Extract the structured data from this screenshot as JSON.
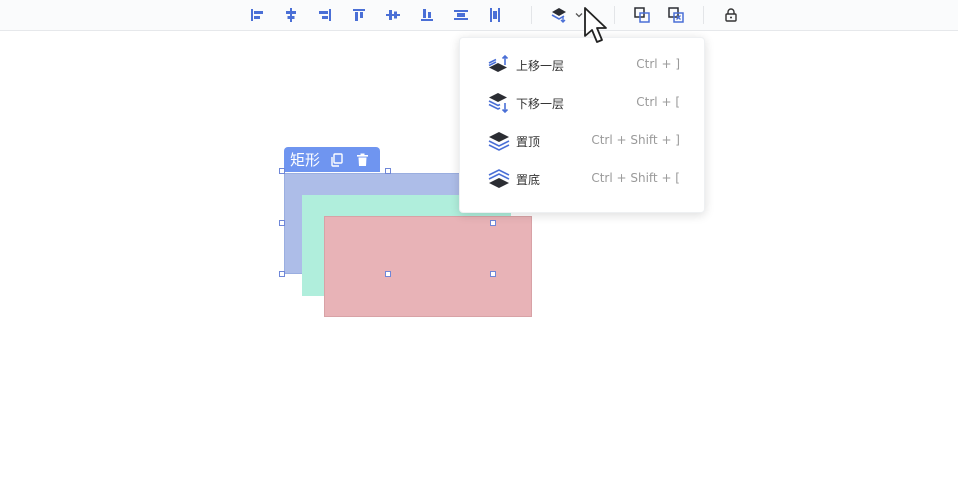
{
  "toolbar": {
    "tools": [
      {
        "name": "align-left-icon"
      },
      {
        "name": "align-center-horizontal-icon"
      },
      {
        "name": "align-right-icon"
      },
      {
        "name": "align-top-icon"
      },
      {
        "name": "align-middle-vertical-icon"
      },
      {
        "name": "align-bottom-icon"
      },
      {
        "name": "distribute-horizontal-icon"
      },
      {
        "name": "distribute-vertical-icon"
      },
      {
        "name": "layer-order-icon"
      },
      {
        "name": "chevron-down-icon"
      },
      {
        "name": "group-icon"
      },
      {
        "name": "ungroup-icon"
      },
      {
        "name": "lock-icon"
      }
    ],
    "accent_color": "#4a6fd6"
  },
  "selection": {
    "label": "矩形",
    "toolbar_color": "#6f95f0",
    "icons": [
      "copy-icon",
      "delete-icon"
    ]
  },
  "shapes": [
    {
      "name": "rectangle-blue",
      "color": "#adbde8"
    },
    {
      "name": "rectangle-green",
      "color": "#b0eedc"
    },
    {
      "name": "rectangle-red",
      "color": "#e8b3b7"
    }
  ],
  "layer_menu": {
    "items": [
      {
        "label": "上移一层",
        "shortcut": "Ctrl + ]",
        "icon": "move-up-layer-icon"
      },
      {
        "label": "下移一层",
        "shortcut": "Ctrl + [",
        "icon": "move-down-layer-icon"
      },
      {
        "label": "置顶",
        "shortcut": "Ctrl + Shift + ]",
        "icon": "bring-to-front-icon"
      },
      {
        "label": "置底",
        "shortcut": "Ctrl + Shift + [",
        "icon": "send-to-back-icon"
      }
    ]
  }
}
